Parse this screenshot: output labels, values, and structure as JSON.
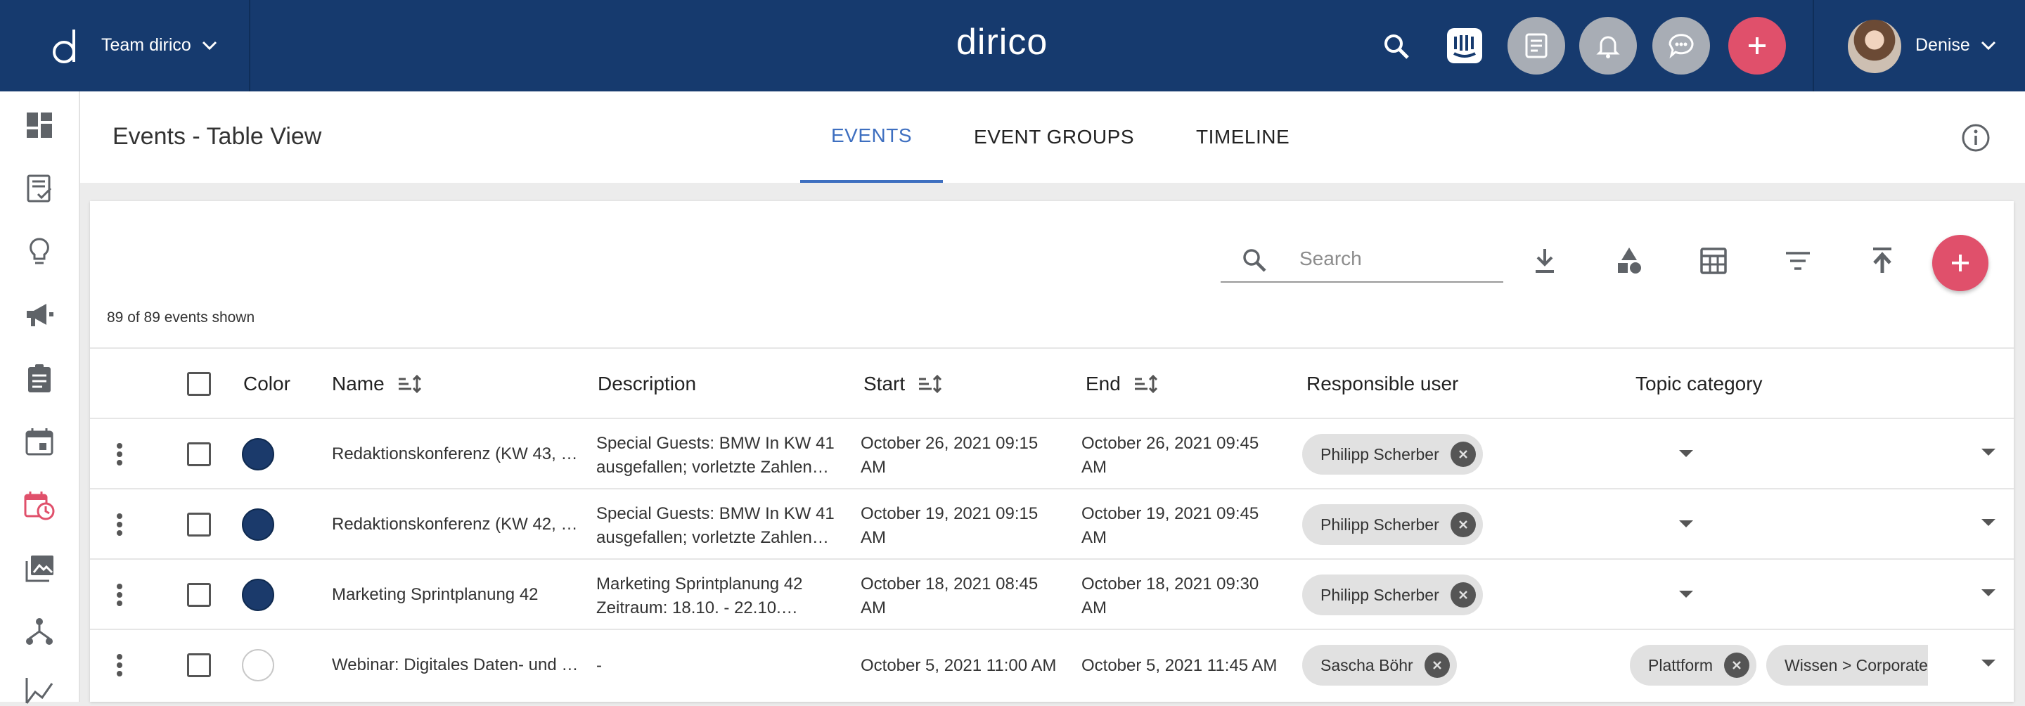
{
  "topbar": {
    "team_label": "Team dirico",
    "brand": "dirico",
    "user_name": "Denise",
    "icons": [
      "logo-icon",
      "search-icon",
      "intercom-icon",
      "tasks-icon",
      "bell-icon",
      "chat-icon",
      "plus-icon"
    ]
  },
  "sidebar": {
    "icons": [
      "dashboard-icon",
      "tasks-icon",
      "lightbulb-icon",
      "megaphone-icon",
      "clipboard-icon",
      "calendar-icon",
      "event-calendar-icon",
      "images-icon",
      "hierarchy-icon",
      "chart-icon"
    ]
  },
  "page": {
    "title": "Events - Table View",
    "tabs": [
      "EVENTS",
      "EVENT GROUPS",
      "TIMELINE"
    ],
    "active_tab": "EVENTS"
  },
  "toolbar": {
    "count_text": "89 of 89 events shown",
    "search_placeholder": "Search"
  },
  "table": {
    "headers": {
      "color": "Color",
      "name": "Name",
      "description": "Description",
      "start": "Start",
      "end": "End",
      "responsible": "Responsible user",
      "topic": "Topic category"
    },
    "rows": [
      {
        "color": "#1b3a6b",
        "name": "Redaktionskonferenz (KW 43, …",
        "desc1": "Special Guests: BMW In KW 41",
        "desc2": "ausgefallen; vorletzte Zahlen…",
        "start1": "October 26, 2021 09:15",
        "start2": "AM",
        "end1": "October 26, 2021 09:45",
        "end2": "AM",
        "users": [
          "Philipp Scherber"
        ],
        "topics": []
      },
      {
        "color": "#1b3a6b",
        "name": "Redaktionskonferenz (KW 42, …",
        "desc1": "Special Guests: BMW In KW 41",
        "desc2": "ausgefallen; vorletzte Zahlen…",
        "start1": "October 19, 2021 09:15",
        "start2": "AM",
        "end1": "October 19, 2021 09:45",
        "end2": "AM",
        "users": [
          "Philipp Scherber"
        ],
        "topics": []
      },
      {
        "color": "#1b3a6b",
        "name": "Marketing Sprintplanung 42",
        "desc1": "Marketing Sprintplanung 42",
        "desc2": "Zeitraum: 18.10. - 22.10.…",
        "start1": "October 18, 2021 08:45",
        "start2": "AM",
        "end1": "October 18, 2021 09:30",
        "end2": "AM",
        "users": [
          "Philipp Scherber"
        ],
        "topics": []
      },
      {
        "color": "#ffffff",
        "name": "Webinar: Digitales Daten- und …",
        "desc1": "-",
        "desc2": "",
        "start1": "October 5, 2021 11:00 AM",
        "start2": "",
        "end1": "October 5, 2021 11:45 AM",
        "end2": "",
        "users": [
          "Sascha Böhr"
        ],
        "topics": [
          "Plattform",
          "Wissen > Corporate"
        ]
      }
    ]
  }
}
